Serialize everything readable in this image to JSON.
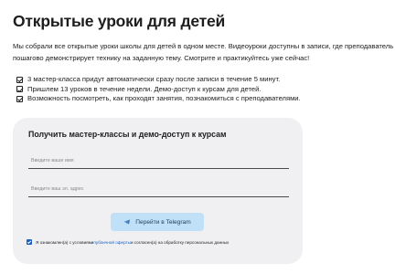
{
  "page": {
    "title": "Открытые уроки для детей",
    "intro": "Мы собрали все открытые уроки школы для детей в одном месте. Видеоуроки доступны в записи, где преподаватель пошагово демонстрирует технику на заданную тему. Смотрите и практикуйтесь уже сейчас!"
  },
  "bullets": [
    "3 мастер-класса придут автоматически сразу после записи в течение 5 минут.",
    "Пришлем 13 уроков в течение недели. Демо-доступ к курсам для детей.",
    "Возможность посмотреть, как проходят занятия, познакомиться с преподавателями."
  ],
  "form": {
    "title": "Получить мастер-классы и демо-доступ к курсам",
    "name_placeholder": "Введите ваше имя",
    "email_placeholder": "Введите ваш эл. адрес",
    "submit_label": "Перейти в Telegram",
    "submit_icon": "telegram-icon",
    "accent_color": "#bfe0f7",
    "consent": {
      "checked": true,
      "prefix": "Я ознакомлен(а) с условиями ",
      "link": "публичной оферты",
      "suffix": " и согласен(а) на обработку персональных данных"
    }
  }
}
